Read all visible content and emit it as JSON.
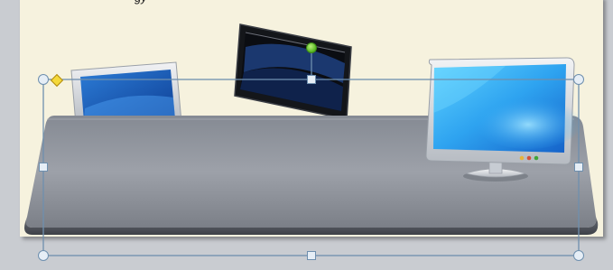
{
  "slide": {
    "text_fragment": "gy"
  },
  "clipart": {
    "items": [
      "laptop",
      "tablet",
      "monitor",
      "desk"
    ]
  },
  "colors": {
    "slide_bg": "#f6f2de",
    "workspace_bg": "#c9ccd1",
    "selection": "#6e8fae",
    "rotate_handle": "#53b51f",
    "adjust_handle": "#f5d93a"
  }
}
